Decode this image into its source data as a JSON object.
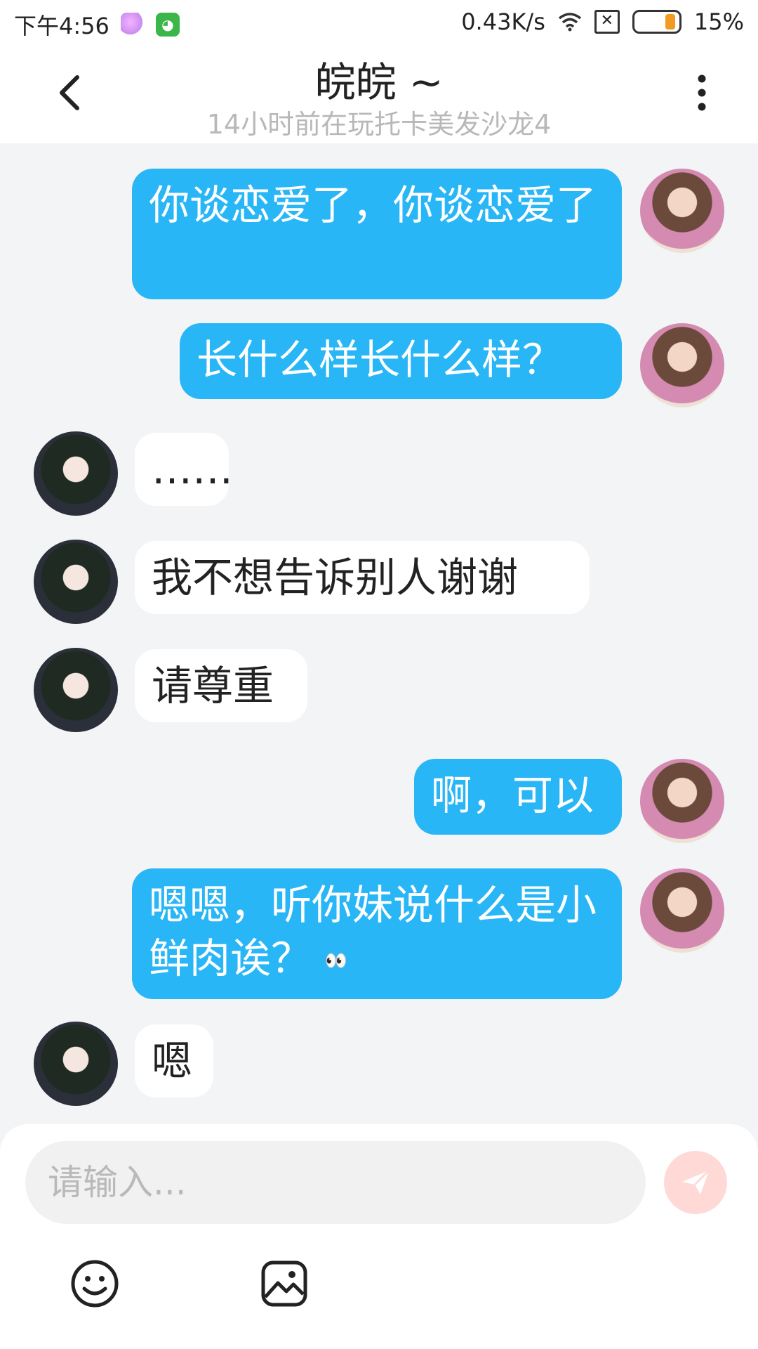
{
  "status_bar": {
    "time": "下午4:56",
    "net_speed": "0.43K/s",
    "battery": "15%"
  },
  "header": {
    "title": "皖皖 ~",
    "subtitle": "14小时前在玩托卡美发沙龙4"
  },
  "messages": [
    {
      "from": "me",
      "text": "你谈恋爱了，你谈恋爱了"
    },
    {
      "from": "me",
      "text": "长什么样长什么样？"
    },
    {
      "from": "other",
      "text": "……"
    },
    {
      "from": "other",
      "text": "我不想告诉别人谢谢"
    },
    {
      "from": "other",
      "text": "请尊重"
    },
    {
      "from": "me",
      "text": "啊，可以"
    },
    {
      "from": "me",
      "text": "嗯嗯，听你妹说什么是小鲜肉诶？",
      "emoji": "👀"
    },
    {
      "from": "other",
      "text": "嗯"
    }
  ],
  "composer": {
    "placeholder": "请输入..."
  },
  "icons": {
    "back": "chevron-left-icon",
    "more": "more-vertical-icon",
    "send": "send-icon",
    "emoji": "smile-icon",
    "image": "image-icon"
  },
  "colors": {
    "my_bubble": "#29b6f6",
    "their_bubble": "#ffffff",
    "background": "#f3f4f6",
    "send_button": "#ffd9d6"
  }
}
